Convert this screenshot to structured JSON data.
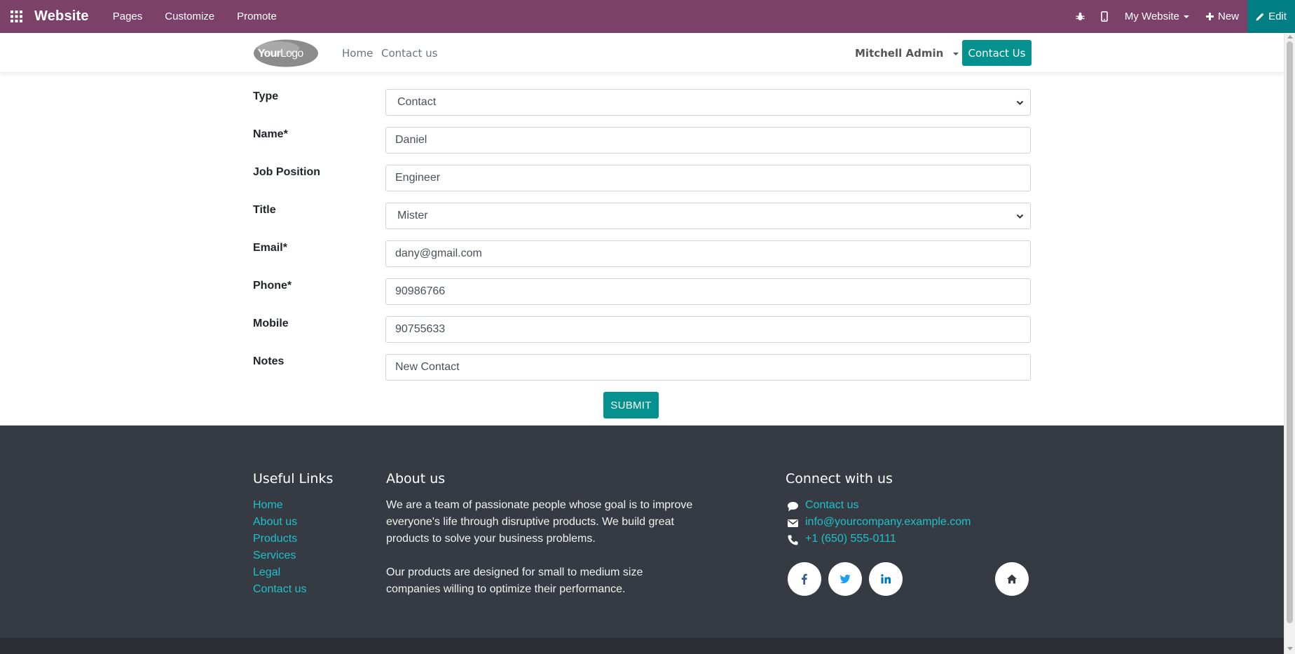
{
  "topbar": {
    "brand": "Website",
    "menus": [
      "Pages",
      "Customize",
      "Promote"
    ],
    "my_website": "My Website",
    "new_label": "New",
    "edit_label": "Edit",
    "color": "#7c4169",
    "edit_color": "#017e84"
  },
  "header": {
    "logo_text_a": "Your",
    "logo_text_b": "Logo",
    "nav": [
      "Home",
      "Contact us"
    ],
    "user": "Mitchell Admin",
    "cta": "Contact Us",
    "cta_color": "#05928e"
  },
  "form": {
    "fields": [
      {
        "label": "Type",
        "value": "Contact",
        "kind": "select"
      },
      {
        "label": "Name*",
        "value": "Daniel",
        "kind": "input"
      },
      {
        "label": "Job Position",
        "value": "Engineer",
        "kind": "input"
      },
      {
        "label": "Title",
        "value": "Mister",
        "kind": "select"
      },
      {
        "label": "Email*",
        "value": "dany@gmail.com",
        "kind": "input"
      },
      {
        "label": "Phone*",
        "value": "90986766",
        "kind": "input"
      },
      {
        "label": "Mobile",
        "value": "90755633",
        "kind": "input"
      },
      {
        "label": "Notes",
        "value": "New Contact",
        "kind": "input"
      }
    ],
    "submit_label": "SUBMIT"
  },
  "footer": {
    "useful_links_title": "Useful Links",
    "useful_links": [
      "Home",
      "About us",
      "Products",
      "Services",
      "Legal",
      "Contact us"
    ],
    "about_title": "About us",
    "about_p1_l1": "We are a team of passionate people whose goal is to improve",
    "about_p1_l2": "everyone's life through disruptive products. We build great",
    "about_p1_l3": "products to solve your business problems.",
    "about_p2_l1": "Our products are designed for small to medium size",
    "about_p2_l2": "companies willing to optimize their performance.",
    "connect_title": "Connect with us",
    "contact_link": "Contact us",
    "email": "info@yourcompany.example.com",
    "phone": "+1 (650) 555-0111",
    "link_color": "#1cc1c9",
    "bg_color": "#363b43"
  }
}
